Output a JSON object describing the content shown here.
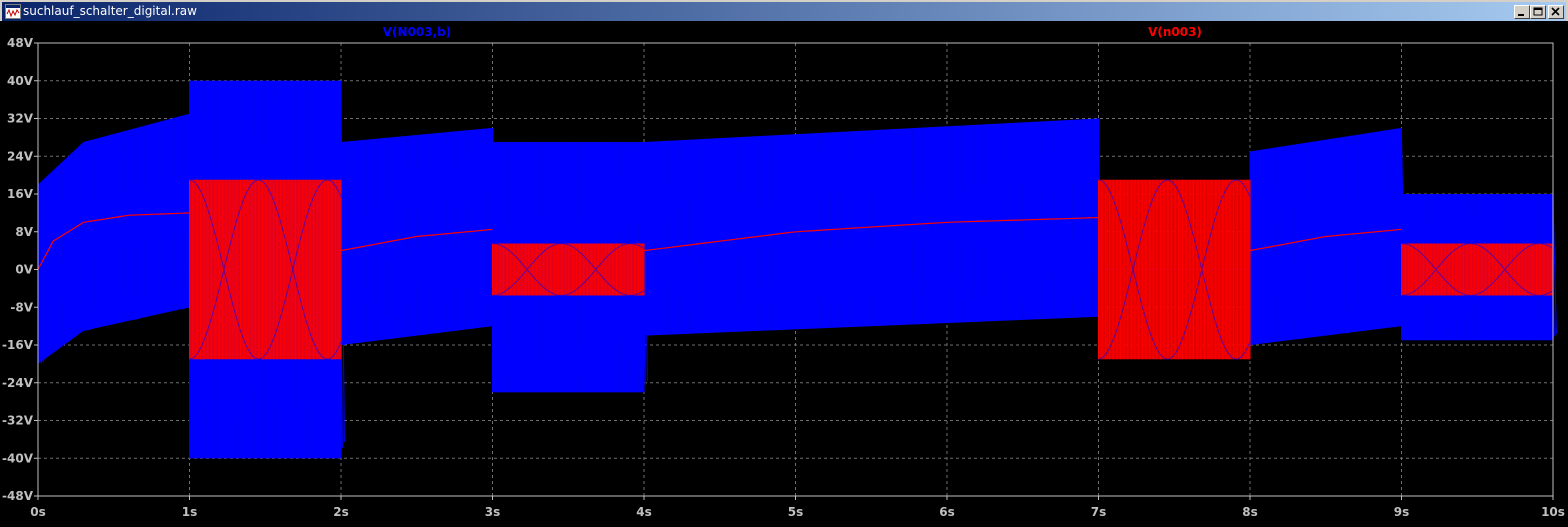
{
  "window": {
    "title": "suchlauf_schalter_digital.raw",
    "buttons": [
      "minimize",
      "maximize",
      "close"
    ]
  },
  "colors": {
    "background": "#000000",
    "grid": "#707070",
    "axis_text": "#c0c0c0",
    "series_1": "#0000ff",
    "series_2": "#ff0000",
    "title_bar": "#0a246a"
  },
  "chart_data": {
    "type": "line",
    "title": "",
    "xlabel": "",
    "ylabel": "",
    "xlim": [
      0,
      10
    ],
    "ylim": [
      -48,
      48
    ],
    "grid": true,
    "x_ticks": [
      "0s",
      "1s",
      "2s",
      "3s",
      "4s",
      "5s",
      "6s",
      "7s",
      "8s",
      "9s",
      "10s"
    ],
    "y_ticks": [
      "48V",
      "40V",
      "32V",
      "24V",
      "16V",
      "8V",
      "0V",
      "-8V",
      "-16V",
      "-24V",
      "-32V",
      "-40V",
      "-48V"
    ],
    "legend": "top",
    "series": [
      {
        "name": "V(N003,b)",
        "color": "#0000ff",
        "segments": [
          {
            "t0": 0,
            "t1": 1,
            "envelope_max": [
              [
                0,
                18
              ],
              [
                0.3,
                27
              ],
              [
                1,
                33
              ]
            ],
            "envelope_min": [
              [
                0,
                -20
              ],
              [
                0.3,
                -13
              ],
              [
                1,
                -8
              ]
            ]
          },
          {
            "t0": 1,
            "t1": 2,
            "envelope_max": [
              [
                1,
                40
              ],
              [
                2,
                40
              ]
            ],
            "envelope_min": [
              [
                1,
                -40
              ],
              [
                2,
                -40
              ]
            ]
          },
          {
            "t0": 2,
            "t1": 3,
            "envelope_max": [
              [
                2,
                27
              ],
              [
                3,
                30
              ]
            ],
            "envelope_min": [
              [
                2,
                -16
              ],
              [
                3,
                -12
              ]
            ]
          },
          {
            "t0": 3,
            "t1": 4,
            "envelope_max": [
              [
                3,
                27
              ],
              [
                4,
                27
              ]
            ],
            "envelope_min": [
              [
                3,
                -26
              ],
              [
                4,
                -26
              ]
            ]
          },
          {
            "t0": 4,
            "t1": 7,
            "envelope_max": [
              [
                4,
                27
              ],
              [
                7,
                32
              ]
            ],
            "envelope_min": [
              [
                4,
                -14
              ],
              [
                7,
                -10
              ]
            ]
          },
          {
            "t0": 7,
            "t1": 8,
            "envelope_max": [
              [
                7,
                0
              ],
              [
                8,
                0
              ]
            ],
            "envelope_min": [
              [
                7,
                0
              ],
              [
                8,
                0
              ]
            ]
          },
          {
            "t0": 8,
            "t1": 9,
            "envelope_max": [
              [
                8,
                25
              ],
              [
                9,
                30
              ]
            ],
            "envelope_min": [
              [
                8,
                -16
              ],
              [
                9,
                -12
              ]
            ]
          },
          {
            "t0": 9,
            "t1": 10,
            "envelope_max": [
              [
                9,
                16
              ],
              [
                10,
                16
              ]
            ],
            "envelope_min": [
              [
                9,
                -15
              ],
              [
                10,
                -15
              ]
            ]
          }
        ]
      },
      {
        "name": "V(n003)",
        "color": "#ff0000",
        "segments": [
          {
            "t0": 0,
            "t1": 1,
            "kind": "charge",
            "values": [
              [
                0,
                0
              ],
              [
                0.1,
                6
              ],
              [
                0.3,
                10
              ],
              [
                0.6,
                11.5
              ],
              [
                1,
                12
              ]
            ]
          },
          {
            "t0": 1,
            "t1": 2,
            "kind": "oscillation",
            "max": 19,
            "min": -19
          },
          {
            "t0": 2,
            "t1": 3,
            "kind": "charge",
            "values": [
              [
                2,
                4
              ],
              [
                2.5,
                7
              ],
              [
                3,
                8.5
              ]
            ]
          },
          {
            "t0": 3,
            "t1": 4,
            "kind": "oscillation",
            "max": 5.5,
            "min": -5.5
          },
          {
            "t0": 4,
            "t1": 7,
            "kind": "charge",
            "values": [
              [
                4,
                4
              ],
              [
                5,
                8
              ],
              [
                6,
                10
              ],
              [
                7,
                11
              ]
            ]
          },
          {
            "t0": 7,
            "t1": 8,
            "kind": "oscillation",
            "max": 19,
            "min": -19
          },
          {
            "t0": 8,
            "t1": 9,
            "kind": "charge",
            "values": [
              [
                8,
                4
              ],
              [
                8.5,
                7
              ],
              [
                9,
                8.5
              ]
            ]
          },
          {
            "t0": 9,
            "t1": 10,
            "kind": "oscillation",
            "max": 5.5,
            "min": -5.5
          }
        ]
      }
    ]
  }
}
